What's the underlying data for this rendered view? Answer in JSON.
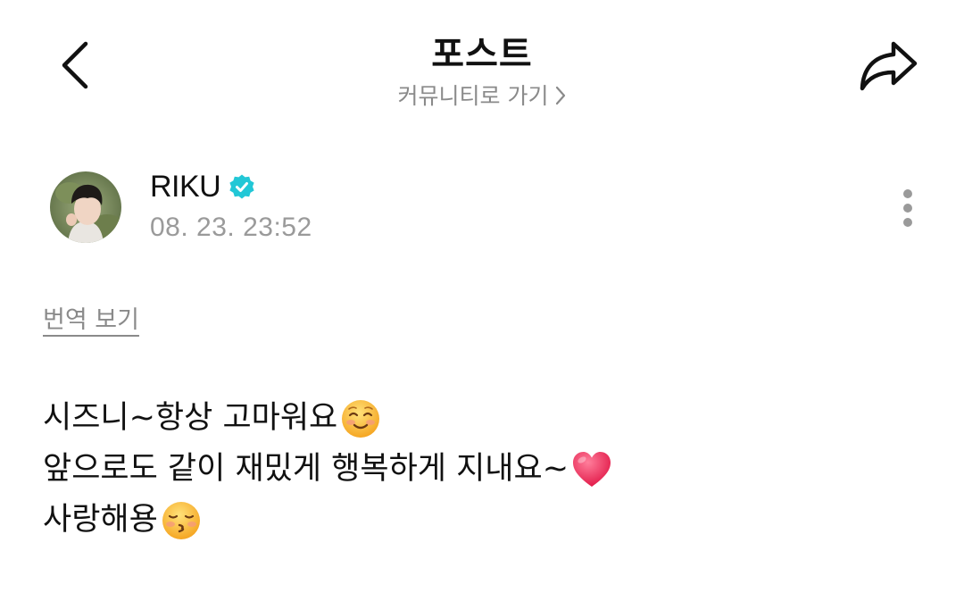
{
  "header": {
    "title": "포스트",
    "community_link": "커뮤니티로 가기",
    "back_icon": "chevron-left-icon",
    "share_icon": "share-arrow-icon"
  },
  "post": {
    "author": {
      "name": "RIKU",
      "verified": true,
      "verified_color": "#22c7d6",
      "timestamp": "08. 23. 23:52"
    },
    "more_icon": "more-vertical-icon",
    "translate_label": "번역 보기",
    "lines": [
      {
        "text": "시즈니~항상 고마워요",
        "emoji": "smiling-face-with-blush-icon"
      },
      {
        "text": "앞으로도 같이 재밌게 행복하게 지내요~",
        "emoji": "red-heart-icon"
      },
      {
        "text": "사랑해용",
        "emoji": "kissing-face-icon"
      }
    ]
  }
}
